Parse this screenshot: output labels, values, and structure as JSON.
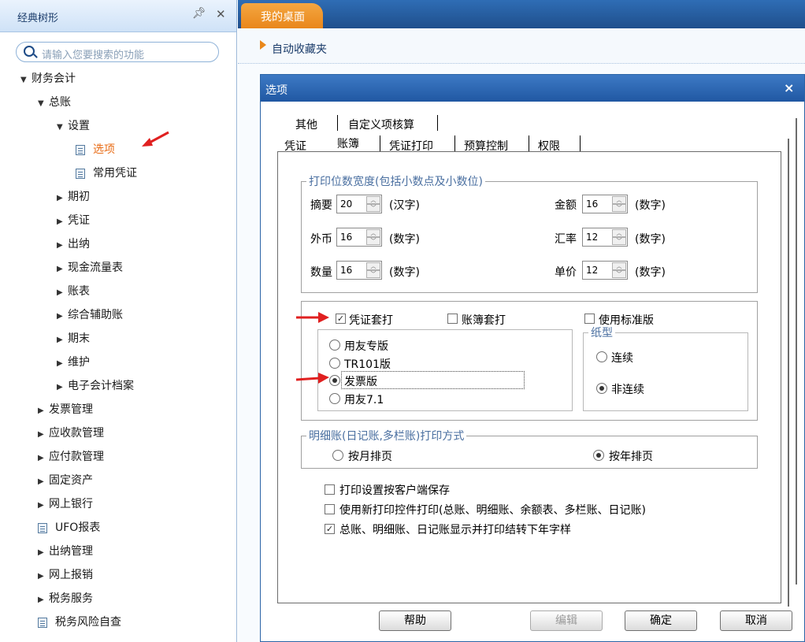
{
  "left_panel": {
    "title": "经典树形",
    "pin_icon": "pin-icon",
    "close_icon": "close-icon",
    "search_placeholder": "请输入您要搜索的功能",
    "tree": [
      {
        "label": "财务会计",
        "expanded": true
      },
      {
        "label": "总账",
        "expanded": true
      },
      {
        "label": "设置",
        "expanded": true
      },
      {
        "label": "选项",
        "selected": true
      },
      {
        "label": "常用凭证"
      },
      {
        "label": "期初"
      },
      {
        "label": "凭证"
      },
      {
        "label": "出纳"
      },
      {
        "label": "现金流量表"
      },
      {
        "label": "账表"
      },
      {
        "label": "综合辅助账"
      },
      {
        "label": "期末"
      },
      {
        "label": "维护"
      },
      {
        "label": "电子会计档案"
      },
      {
        "label": "发票管理"
      },
      {
        "label": "应收款管理"
      },
      {
        "label": "应付款管理"
      },
      {
        "label": "固定资产"
      },
      {
        "label": "网上银行"
      },
      {
        "label": "UFO报表"
      },
      {
        "label": "出纳管理"
      },
      {
        "label": "网上报销"
      },
      {
        "label": "税务服务"
      },
      {
        "label": "税务风险自查"
      }
    ]
  },
  "header": {
    "active_tab": "我的桌面",
    "favorites_label": "自动收藏夹"
  },
  "dialog": {
    "title": "选项",
    "close_label": "×",
    "tabs_row1": [
      "其他",
      "自定义项核算"
    ],
    "tabs_row2": [
      "凭证",
      "账簿",
      "凭证打印",
      "预算控制",
      "权限"
    ],
    "active_tab": "账簿",
    "print_width": {
      "legend": "打印位数宽度(包括小数点及小数位)",
      "fields": [
        {
          "label": "摘要",
          "value": "20",
          "unit": "(汉字)"
        },
        {
          "label": "金额",
          "value": "16",
          "unit": "(数字)"
        },
        {
          "label": "外币",
          "value": "16",
          "unit": "(数字)"
        },
        {
          "label": "汇率",
          "value": "12",
          "unit": "(数字)"
        },
        {
          "label": "数量",
          "value": "16",
          "unit": "(数字)"
        },
        {
          "label": "单价",
          "value": "12",
          "unit": "(数字)"
        }
      ]
    },
    "voucher_print": {
      "voucher_overprint": {
        "label": "凭证套打",
        "checked": true
      },
      "book_overprint": {
        "label": "账簿套打",
        "checked": false
      },
      "standard_edition": {
        "label": "使用标准版",
        "checked": false
      },
      "editions": [
        {
          "label": "用友专版",
          "selected": false
        },
        {
          "label": "TR101版",
          "selected": false
        },
        {
          "label": "发票版",
          "selected": true
        },
        {
          "label": "用友7.1",
          "selected": false
        }
      ],
      "paper_legend": "纸型",
      "paper": [
        {
          "label": "连续",
          "selected": false
        },
        {
          "label": "非连续",
          "selected": true
        }
      ]
    },
    "detail_print": {
      "legend": "明细账(日记账,多栏账)打印方式",
      "options": [
        {
          "label": "按月排页",
          "selected": false
        },
        {
          "label": "按年排页",
          "selected": true
        }
      ]
    },
    "checkboxes": [
      {
        "label": "打印设置按客户端保存",
        "checked": false
      },
      {
        "label": "使用新打印控件打印(总账、明细账、余额表、多栏账、日记账)",
        "checked": false
      },
      {
        "label": "总账、明细账、日记账显示并打印结转下年字样",
        "checked": true
      }
    ],
    "buttons": {
      "help": "帮助",
      "edit": "编辑",
      "ok": "确定",
      "cancel": "取消"
    }
  },
  "colors": {
    "accent_orange": "#e9871b",
    "title_blue": "#2058a3",
    "arrow_red": "#e02020"
  }
}
